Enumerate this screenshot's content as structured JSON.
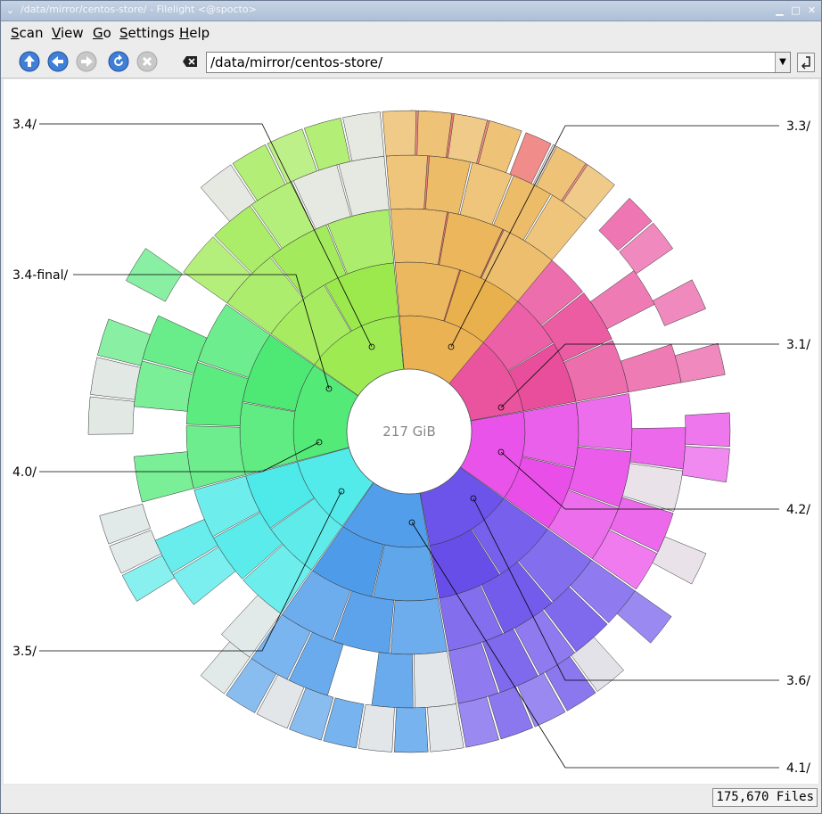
{
  "window": {
    "title": "/data/mirror/centos-store/ - Filelight <@spocto>",
    "controls": [
      "minimize",
      "maximize",
      "close"
    ]
  },
  "menubar": {
    "items": [
      {
        "label": "Scan",
        "accel": "S"
      },
      {
        "label": "View",
        "accel": "V"
      },
      {
        "label": "Go",
        "accel": "G"
      },
      {
        "label": "Settings",
        "accel": "S"
      },
      {
        "label": "Help",
        "accel": "H"
      }
    ]
  },
  "toolbar": {
    "buttons": [
      {
        "name": "up",
        "icon": "arrow-up-icon",
        "enabled": true
      },
      {
        "name": "back",
        "icon": "arrow-left-icon",
        "enabled": true
      },
      {
        "name": "forward",
        "icon": "arrow-right-icon",
        "enabled": false
      },
      {
        "name": "rescan",
        "icon": "refresh-icon",
        "enabled": true
      },
      {
        "name": "stop",
        "icon": "stop-icon",
        "enabled": false
      }
    ]
  },
  "location": {
    "path": "/data/mirror/centos-store/"
  },
  "map": {
    "center_label": "217 GiB",
    "segments": [
      {
        "label": "3.1/",
        "start": 0,
        "end": 37,
        "hue": 2
      },
      {
        "label": "4.2/",
        "start": 37,
        "end": 80,
        "hue": 330
      },
      {
        "label": "3.6/",
        "start": 80,
        "end": 125,
        "hue": 300
      },
      {
        "label": "4.1/",
        "start": 125,
        "end": 170,
        "hue": 250
      },
      {
        "label": "3.5/",
        "start": 170,
        "end": 215,
        "hue": 210
      },
      {
        "label": "4.0/",
        "start": 215,
        "end": 255,
        "hue": 180
      },
      {
        "label": "3.4-final/",
        "start": 255,
        "end": 305,
        "hue": 135
      },
      {
        "label": "3.4/",
        "start": 305,
        "end": 355,
        "hue": 90
      },
      {
        "label": "3.3/",
        "start": 355,
        "end": 400,
        "hue": 38
      }
    ],
    "callouts": [
      {
        "label": "3.4/",
        "side": "left"
      },
      {
        "label": "3.3/",
        "side": "right"
      },
      {
        "label": "3.4-final/",
        "side": "left"
      },
      {
        "label": "3.1/",
        "side": "right"
      },
      {
        "label": "4.0/",
        "side": "left"
      },
      {
        "label": "4.2/",
        "side": "right"
      },
      {
        "label": "3.5/",
        "side": "left"
      },
      {
        "label": "3.6/",
        "side": "right"
      },
      {
        "label": "4.1/",
        "side": "right"
      }
    ]
  },
  "status": {
    "files": "175,670 Files"
  }
}
